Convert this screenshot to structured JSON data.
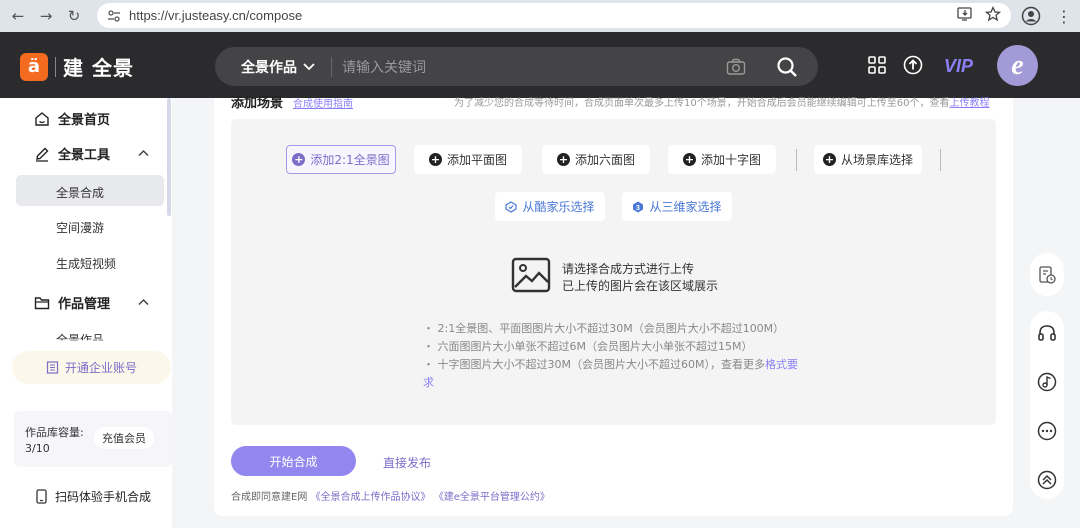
{
  "browser": {
    "url": "https://vr.justeasy.cn/compose"
  },
  "header": {
    "logo_text": "建 全景",
    "search": {
      "category": "全景作品",
      "placeholder": "请输入关键词"
    },
    "vip": "VIP",
    "avatar_letter": "e",
    "icons": [
      "grid-icon",
      "upload-icon",
      "camera-icon",
      "search-icon"
    ]
  },
  "sidebar": {
    "home": "全景首页",
    "tools": "全景工具",
    "tools_items": [
      "全景合成",
      "空间漫游",
      "生成短视频"
    ],
    "works": "作品管理",
    "works_items": [
      "全景作品"
    ],
    "enterprise": "开通企业账号",
    "storage_label": "作品库容量:",
    "storage_count": "3/10",
    "recharge": "充值会员",
    "scan": "扫码体验手机合成"
  },
  "main": {
    "title": "添加场景",
    "guide": "合成使用指南",
    "note": "为了减少您的合成等待时间，合成页面单次最多上传10个场景，开始合成后会员能继续编辑可上传至60个，查看",
    "note_link": "上传教程",
    "buttons_row1": [
      "添加2:1全景图",
      "添加平面图",
      "添加六面图",
      "添加十字图",
      "从场景库选择"
    ],
    "buttons_row2": [
      "从酷家乐选择",
      "从三维家选择"
    ],
    "hint_line1": "请选择合成方式进行上传",
    "hint_line2": "已上传的图片会在该区域展示",
    "rules": [
      "2:1全景图、平面图图片大小不超过30M（会员图片大小不超过100M）",
      "六面图图片大小单张不超过6M（会员图片大小单张不超过15M）",
      "十字图图片大小不超过30M（会员图片大小不超过60M），查看更多"
    ],
    "rules_link": "格式要求",
    "start_button": "开始合成",
    "publish_button": "直接发布",
    "agree_prefix": "合成即同意建E网",
    "agree_link1": "《全景合成上传作品协议》",
    "agree_link2": "《建e全景平台管理公约》"
  },
  "colors": {
    "accent": "#9386ee",
    "header_bg": "#2b2b2d",
    "logo": "#f46a1f"
  }
}
